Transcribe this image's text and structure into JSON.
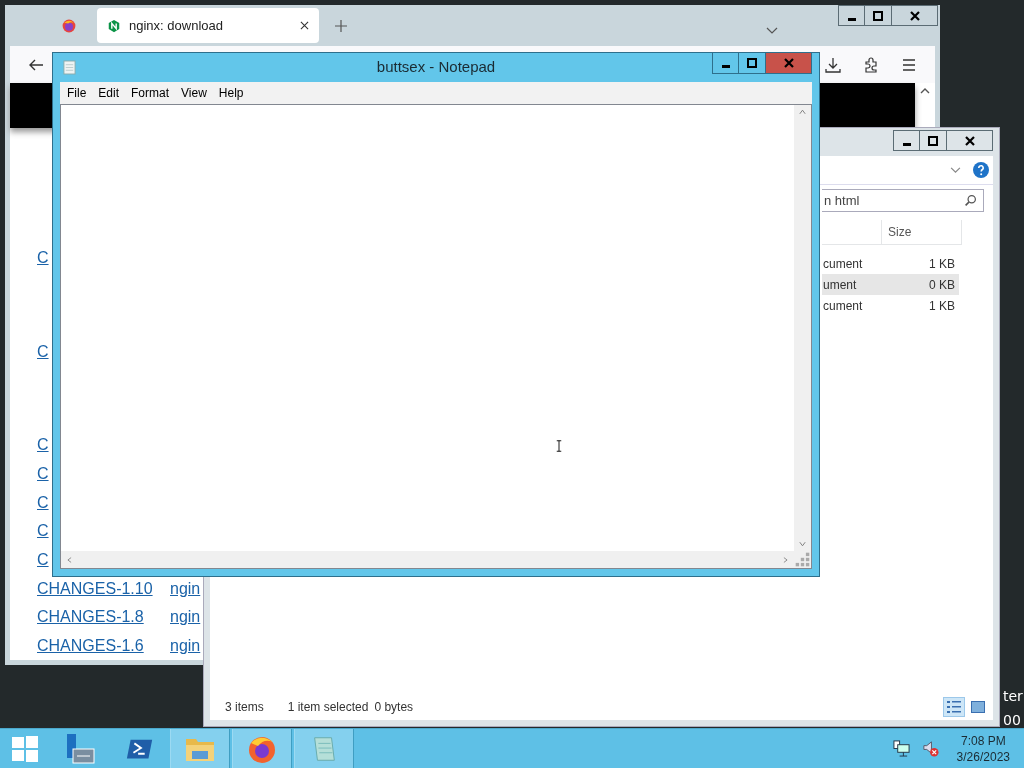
{
  "browser": {
    "tabs": [
      {
        "label": "nginx: download",
        "selected": true
      }
    ],
    "link_groups": [
      [
        {
          "name": "C"
        }
      ],
      [
        {
          "name": "C"
        }
      ],
      [
        {
          "name": "C"
        },
        {
          "name": "C"
        },
        {
          "name": "C"
        },
        {
          "name": "C"
        },
        {
          "name": "C"
        },
        {
          "name": "CHANGES-1.10",
          "file": "ngin"
        },
        {
          "name": "CHANGES-1.8",
          "file": "ngin"
        },
        {
          "name": "CHANGES-1.6",
          "file": "ngin"
        }
      ]
    ]
  },
  "explorer": {
    "search": {
      "placeholder": "n html"
    },
    "columns": [
      "Size"
    ],
    "rows": [
      {
        "type": "cument",
        "size": "1 KB",
        "selected": false
      },
      {
        "type": "ument",
        "size": "0 KB",
        "selected": true
      },
      {
        "type": "cument",
        "size": "1 KB",
        "selected": false
      }
    ],
    "status_bar": {
      "count": "3 items",
      "selection": "1 item selected",
      "size": "0 bytes"
    },
    "views": [
      {
        "kind": "details",
        "selected": true
      },
      {
        "kind": "large",
        "selected": false
      }
    ]
  },
  "notepad": {
    "title": "buttsex - Notepad",
    "menu": [
      "File",
      "Edit",
      "Format",
      "View",
      "Help"
    ]
  },
  "desktop": {
    "texts": [
      "ter",
      "00"
    ]
  },
  "taskbar": {
    "apps": [
      {
        "kind": "server",
        "running": false
      },
      {
        "kind": "shell",
        "running": false
      },
      {
        "kind": "folder",
        "running": true
      },
      {
        "kind": "firefox",
        "running": true
      },
      {
        "kind": "notepad",
        "running": true
      }
    ],
    "clock": {
      "time": "7:08 PM",
      "date": "3/26/2023"
    }
  }
}
